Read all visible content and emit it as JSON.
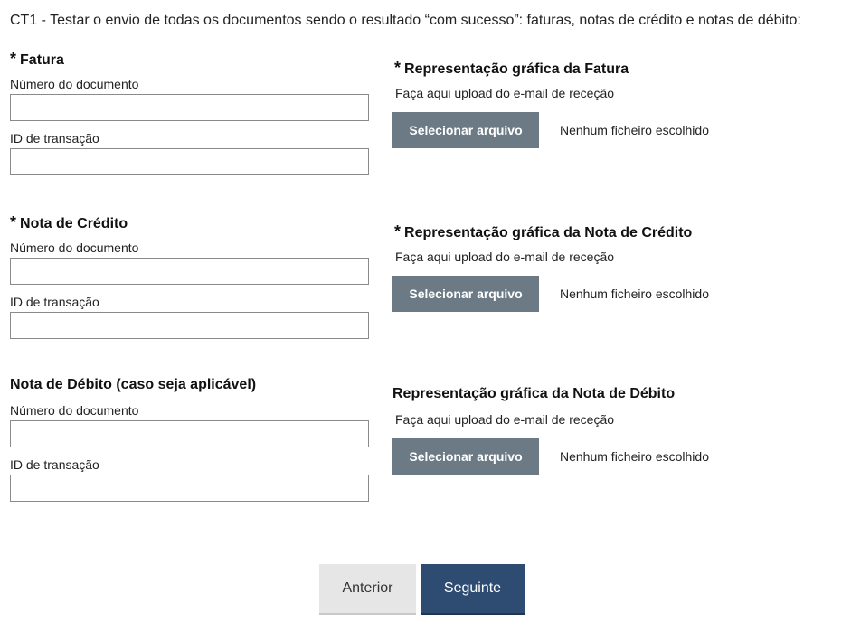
{
  "intro": "CT1 - Testar o envio de todas os documentos sendo o resultado “com sucesso”: faturas, notas de crédito e notas de débito:",
  "required_marker": "*",
  "sections": [
    {
      "title": "Fatura",
      "required": true,
      "doc_number_label": "Número do documento",
      "doc_number_value": "",
      "transaction_id_label": "ID de transação",
      "transaction_id_value": "",
      "upload_title": "Representação gráfica da Fatura",
      "upload_required": true,
      "upload_hint": "Faça aqui upload do e-mail de receção",
      "upload_button": "Selecionar arquivo",
      "upload_status": "Nenhum ficheiro escolhido"
    },
    {
      "title": "Nota de Crédito",
      "required": true,
      "doc_number_label": "Número do documento",
      "doc_number_value": "",
      "transaction_id_label": "ID de transação",
      "transaction_id_value": "",
      "upload_title": "Representação gráfica da Nota de Crédito",
      "upload_required": true,
      "upload_hint": "Faça aqui upload do e-mail de receção",
      "upload_button": "Selecionar arquivo",
      "upload_status": "Nenhum ficheiro escolhido"
    },
    {
      "title": "Nota de Débito (caso seja aplicável)",
      "required": false,
      "doc_number_label": "Número do documento",
      "doc_number_value": "",
      "transaction_id_label": "ID de transação",
      "transaction_id_value": "",
      "upload_title": "Representação gráfica da Nota de Débito",
      "upload_required": false,
      "upload_hint": "Faça aqui upload do e-mail de receção",
      "upload_button": "Selecionar arquivo",
      "upload_status": "Nenhum ficheiro escolhido"
    }
  ],
  "navigation": {
    "previous_label": "Anterior",
    "next_label": "Seguinte"
  },
  "colors": {
    "file_button_bg": "#6b7a84",
    "next_button_bg": "#2e4c72",
    "previous_button_bg": "#e6e6e6"
  }
}
